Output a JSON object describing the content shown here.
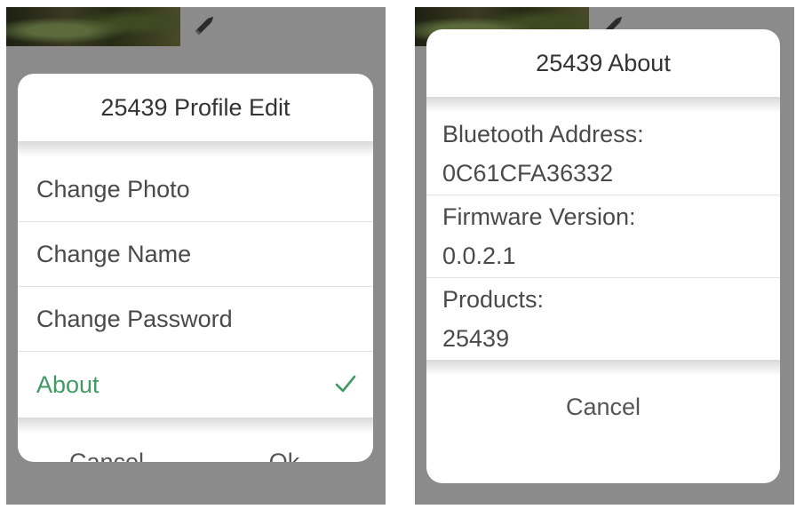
{
  "profile_edit": {
    "title": "25439 Profile Edit",
    "items": [
      {
        "label": "Change Photo"
      },
      {
        "label": "Change Name"
      },
      {
        "label": "Change Password"
      },
      {
        "label": "About",
        "selected": true
      }
    ],
    "cancel_label": "Cancel",
    "ok_label": "Ok",
    "accent_color": "#3f9a63"
  },
  "about": {
    "title": "25439 About",
    "fields": [
      {
        "label": "Bluetooth Address:",
        "value": "0C61CFA36332"
      },
      {
        "label": "Firmware Version:",
        "value": "0.0.2.1"
      },
      {
        "label": "Products:",
        "value": "25439"
      }
    ],
    "cancel_label": "Cancel"
  },
  "icons": {
    "edit": "pencil-icon",
    "selected": "checkmark-icon"
  }
}
